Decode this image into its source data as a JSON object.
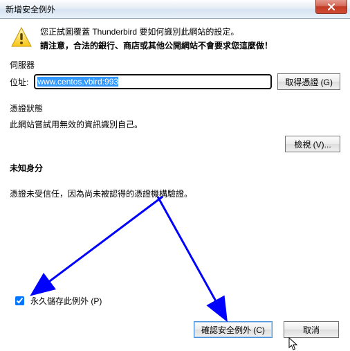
{
  "window": {
    "title": "新增安全例外"
  },
  "warning": {
    "line1": "您正試圖覆蓋 Thunderbird 要如何識別此網站的設定。",
    "line2": "請注意，合法的銀行、商店或其他公開網站不會要求您這麼做！"
  },
  "server": {
    "section_label": "伺服器",
    "location_label": "位址:",
    "url": "www.centos.vbird:993",
    "get_cert_button": "取得憑證 (G)"
  },
  "cert_status": {
    "section_label": "憑證狀態",
    "desc": "此網站嘗試用無效的資訊識別自己。",
    "view_button": "檢視 (V)..."
  },
  "identity": {
    "heading": "未知身分",
    "desc": "憑證未受信任，因為尚未被認得的憑證機構驗證。"
  },
  "permanent": {
    "label": "永久儲存此例外 (P)",
    "checked": true
  },
  "buttons": {
    "confirm": "確認安全例外 (C)",
    "cancel": "取消"
  }
}
